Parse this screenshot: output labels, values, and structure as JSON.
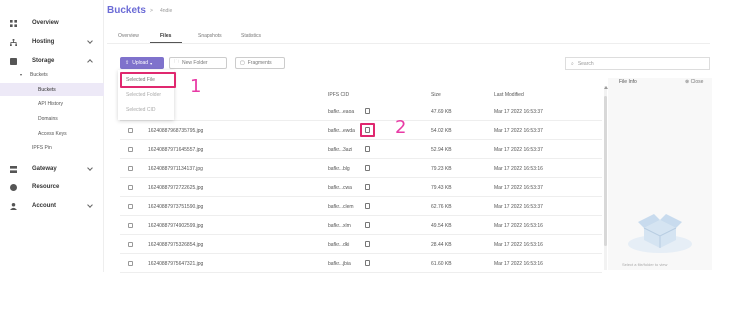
{
  "sidebar": {
    "items": [
      {
        "label": "Overview",
        "icon": "grid-icon"
      },
      {
        "label": "Hosting",
        "icon": "sitemap-icon"
      },
      {
        "label": "Storage",
        "icon": "database-icon"
      },
      {
        "label": "Gateway",
        "icon": "server-icon"
      },
      {
        "label": "Resource",
        "icon": "circle-icon"
      },
      {
        "label": "Account",
        "icon": "user-icon"
      }
    ],
    "buckets_group": "Buckets",
    "sub": [
      "Buckets",
      "API History",
      "Domains",
      "Access Keys",
      "IPFS Pin"
    ]
  },
  "header": {
    "title": "Buckets",
    "separator": ">",
    "crumb": "4ndie"
  },
  "tabs": [
    "Overview",
    "Files",
    "Snapshots",
    "Statistics"
  ],
  "toolbar": {
    "upload": "Upload",
    "new_folder": "New Folder",
    "fragments": "Fragments",
    "search_placeholder": "Search"
  },
  "dropdown": [
    "Selected File",
    "Selected Folder",
    "Selected CID"
  ],
  "annotations": {
    "one": "1",
    "two": "2"
  },
  "table": {
    "headers": {
      "cid": "IPFS CID",
      "size": "Size",
      "modified": "Last Modified"
    },
    "rows": [
      {
        "name": "",
        "cid": "bafkr...eaoa",
        "size": "47.69 KB",
        "modified": "Mar 17 2022 16:53:37"
      },
      {
        "name": "16240887968735795.jpg",
        "cid": "bafkr...ewda",
        "size": "54.02 KB",
        "modified": "Mar 17 2022 16:53:37"
      },
      {
        "name": "16240887971645557.jpg",
        "cid": "bafkr...3azi",
        "size": "52.94 KB",
        "modified": "Mar 17 2022 16:53:37"
      },
      {
        "name": "16240887971134137.jpg",
        "cid": "bafkr...blg",
        "size": "79.23 KB",
        "modified": "Mar 17 2022 16:53:16"
      },
      {
        "name": "16240887972722625.jpg",
        "cid": "bafkr...cwa",
        "size": "79.43 KB",
        "modified": "Mar 17 2022 16:53:37"
      },
      {
        "name": "16240887973751590.jpg",
        "cid": "bafkr...clem",
        "size": "62.76 KB",
        "modified": "Mar 17 2022 16:53:37"
      },
      {
        "name": "16240887974902599.jpg",
        "cid": "bafkr...xlm",
        "size": "49.54 KB",
        "modified": "Mar 17 2022 16:53:16"
      },
      {
        "name": "16240887975326854.jpg",
        "cid": "bafkr...dki",
        "size": "28.44 KB",
        "modified": "Mar 17 2022 16:53:16"
      },
      {
        "name": "16240887975647321.jpg",
        "cid": "bafkr...jbia",
        "size": "61.60 KB",
        "modified": "Mar 17 2022 16:53:16"
      }
    ]
  },
  "file_info": {
    "title": "File Info",
    "close": "Close",
    "hint": "Select a file/folder to view"
  },
  "colors": {
    "accent": "#7f72cc",
    "title": "#6b6bd6",
    "annotation": "#e0286f"
  }
}
